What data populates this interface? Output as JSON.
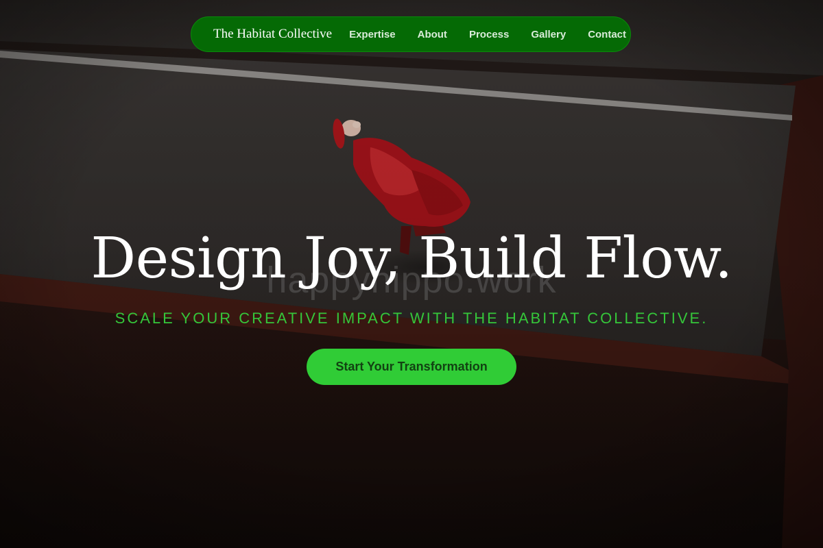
{
  "nav": {
    "brand": "The Habitat Collective",
    "links": [
      {
        "label": "Expertise"
      },
      {
        "label": "About"
      },
      {
        "label": "Process"
      },
      {
        "label": "Gallery"
      },
      {
        "label": "Contact"
      }
    ]
  },
  "hero": {
    "headline": "Design Joy, Build Flow.",
    "tagline": "SCALE YOUR CREATIVE IMPACT WITH THE HABITAT COLLECTIVE.",
    "cta_label": "Start Your Transformation",
    "watermark": "happyhippo.work"
  },
  "colors": {
    "nav_bg": "#056a05",
    "accent": "#30cc36",
    "tagline": "#35c63a",
    "headline": "#ffffff"
  }
}
